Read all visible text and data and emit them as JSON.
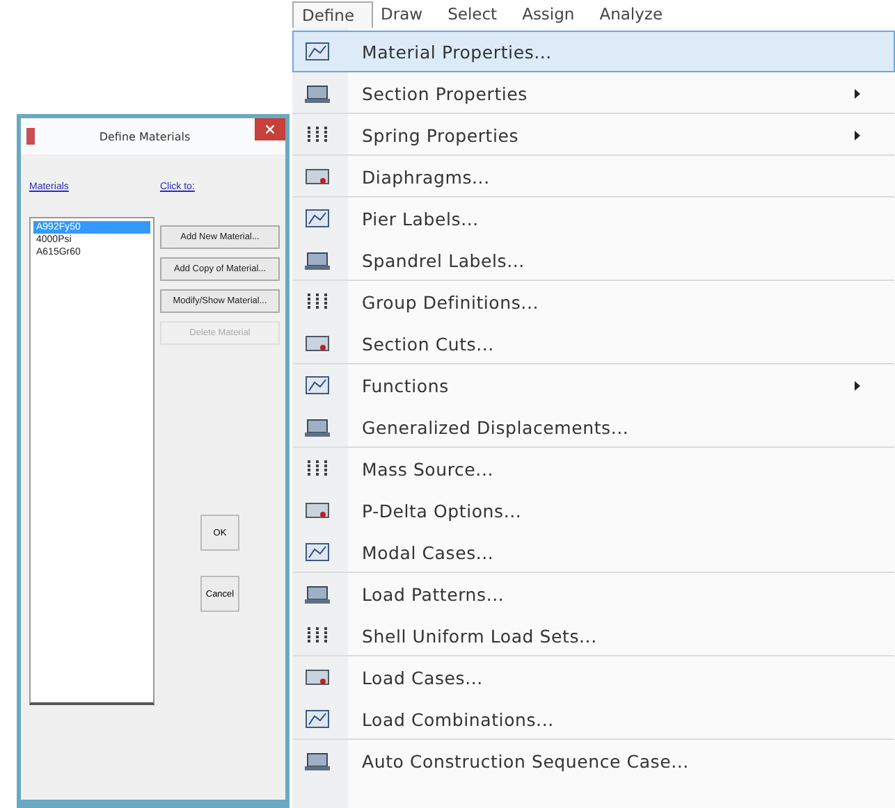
{
  "dialog": {
    "title": "Define Materials",
    "materials_label": "Materials",
    "click_label": "Click to:",
    "materials": [
      {
        "label": "A992Fy50",
        "selected": true
      },
      {
        "label": "4000Psi",
        "selected": false
      },
      {
        "label": "A615Gr60",
        "selected": false
      }
    ],
    "actions": [
      {
        "label": "Add New Material...",
        "disabled": false
      },
      {
        "label": "Add Copy of Material...",
        "disabled": false
      },
      {
        "label": "Modify/Show Material...",
        "disabled": false
      },
      {
        "label": "Delete Material",
        "disabled": true
      }
    ],
    "buttons": [
      "OK",
      "Cancel"
    ]
  },
  "menubar": [
    {
      "label": "Define",
      "selected": true
    },
    {
      "label": "Draw",
      "selected": false
    },
    {
      "label": "Select",
      "selected": false
    },
    {
      "label": "Assign",
      "selected": false
    },
    {
      "label": "Analyze",
      "selected": false
    }
  ],
  "menu": [
    {
      "label": "Material Properties...",
      "selected": true,
      "submenu": false,
      "separator_after": false
    },
    {
      "label": "Section Properties",
      "selected": false,
      "submenu": true,
      "separator_after": true
    },
    {
      "label": "Spring Properties",
      "selected": false,
      "submenu": true,
      "separator_after": true
    },
    {
      "label": "Diaphragms...",
      "selected": false,
      "submenu": false,
      "separator_after": true
    },
    {
      "label": "Pier Labels...",
      "selected": false,
      "submenu": false,
      "separator_after": false
    },
    {
      "label": "Spandrel Labels...",
      "selected": false,
      "submenu": false,
      "separator_after": true
    },
    {
      "label": "Group Definitions...",
      "selected": false,
      "submenu": false,
      "separator_after": false
    },
    {
      "label": "Section Cuts...",
      "selected": false,
      "submenu": false,
      "separator_after": true
    },
    {
      "label": "Functions",
      "selected": false,
      "submenu": true,
      "separator_after": false
    },
    {
      "label": "Generalized Displacements...",
      "selected": false,
      "submenu": false,
      "separator_after": true
    },
    {
      "label": "Mass Source...",
      "selected": false,
      "submenu": false,
      "separator_after": false
    },
    {
      "label": "P-Delta Options...",
      "selected": false,
      "submenu": false,
      "separator_after": false
    },
    {
      "label": "Modal Cases...",
      "selected": false,
      "submenu": false,
      "separator_after": true
    },
    {
      "label": "Load Patterns...",
      "selected": false,
      "submenu": false,
      "separator_after": false
    },
    {
      "label": "Shell Uniform Load Sets...",
      "selected": false,
      "submenu": false,
      "separator_after": true
    },
    {
      "label": "Load Cases...",
      "selected": false,
      "submenu": false,
      "separator_after": false
    },
    {
      "label": "Load Combinations...",
      "selected": false,
      "submenu": false,
      "separator_after": true
    },
    {
      "label": "Auto Construction Sequence Case...",
      "selected": false,
      "submenu": false,
      "separator_after": false
    }
  ]
}
